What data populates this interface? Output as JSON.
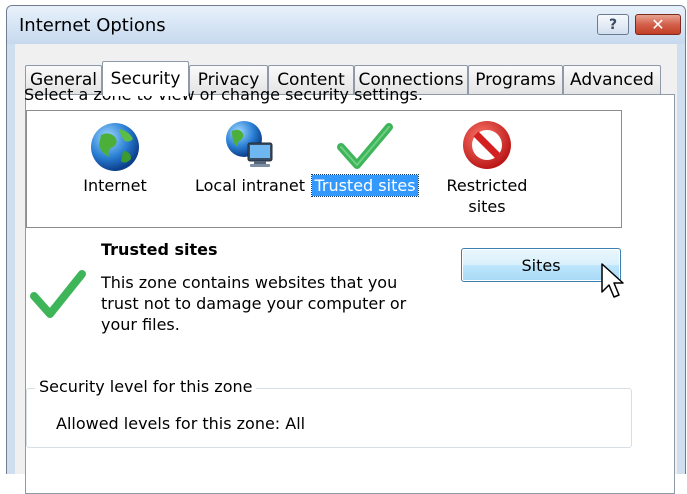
{
  "window": {
    "title": "Internet Options",
    "help_label": "?",
    "close_label": "✕"
  },
  "tabs": [
    {
      "label": "General"
    },
    {
      "label": "Security",
      "active": true
    },
    {
      "label": "Privacy"
    },
    {
      "label": "Content"
    },
    {
      "label": "Connections"
    },
    {
      "label": "Programs"
    },
    {
      "label": "Advanced"
    }
  ],
  "security": {
    "zone_prompt": "Select a zone to view or change security settings.",
    "zones": [
      {
        "label": "Internet",
        "icon": "globe-icon"
      },
      {
        "label": "Local intranet",
        "icon": "intranet-icon"
      },
      {
        "label": "Trusted sites",
        "icon": "checkmark-icon",
        "selected": true
      },
      {
        "label_line1": "Restricted",
        "label_line2": "sites",
        "icon": "restricted-icon"
      }
    ],
    "selected_zone": {
      "title": "Trusted sites",
      "description": "This zone contains websites that you trust not to damage your computer or your files."
    },
    "sites_button": "Sites",
    "level_group_label": "Security level for this zone",
    "allowed_levels": "Allowed levels for this zone: All"
  },
  "colors": {
    "selection": "#3399ff",
    "check_green": "#3fb55a",
    "restricted_red": "#d42020",
    "close_red": "#c23f27"
  }
}
